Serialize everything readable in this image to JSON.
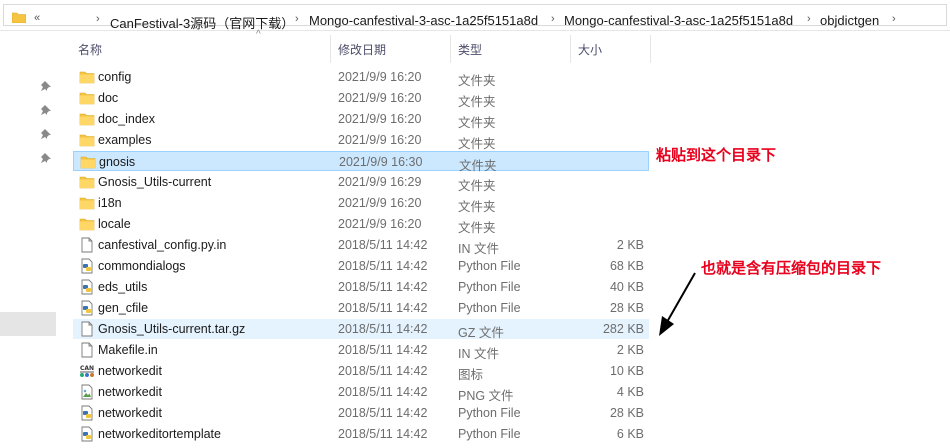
{
  "breadcrumb": {
    "back_glyph": "«",
    "items": [
      "CanFestival-3源码（官网下载）",
      "Mongo-canfestival-3-asc-1a25f5151a8d",
      "Mongo-canfestival-3-asc-1a25f5151a8d",
      "objdictgen"
    ]
  },
  "columns": {
    "name": "名称",
    "date": "修改日期",
    "type": "类型",
    "size": "大小"
  },
  "files": [
    {
      "name": "config",
      "date": "2021/9/9 16:20",
      "type": "文件夹",
      "size": "",
      "icon": "folder-icon",
      "state": ""
    },
    {
      "name": "doc",
      "date": "2021/9/9 16:20",
      "type": "文件夹",
      "size": "",
      "icon": "folder-icon",
      "state": ""
    },
    {
      "name": "doc_index",
      "date": "2021/9/9 16:20",
      "type": "文件夹",
      "size": "",
      "icon": "folder-icon",
      "state": ""
    },
    {
      "name": "examples",
      "date": "2021/9/9 16:20",
      "type": "文件夹",
      "size": "",
      "icon": "folder-icon",
      "state": ""
    },
    {
      "name": "gnosis",
      "date": "2021/9/9 16:30",
      "type": "文件夹",
      "size": "",
      "icon": "folder-icon",
      "state": "selected"
    },
    {
      "name": "Gnosis_Utils-current",
      "date": "2021/9/9 16:29",
      "type": "文件夹",
      "size": "",
      "icon": "folder-icon",
      "state": ""
    },
    {
      "name": "i18n",
      "date": "2021/9/9 16:20",
      "type": "文件夹",
      "size": "",
      "icon": "folder-icon",
      "state": ""
    },
    {
      "name": "locale",
      "date": "2021/9/9 16:20",
      "type": "文件夹",
      "size": "",
      "icon": "folder-icon",
      "state": ""
    },
    {
      "name": "canfestival_config.py.in",
      "date": "2018/5/11 14:42",
      "type": "IN 文件",
      "size": "2 KB",
      "icon": "file-icon",
      "state": ""
    },
    {
      "name": "commondialogs",
      "date": "2018/5/11 14:42",
      "type": "Python File",
      "size": "68 KB",
      "icon": "python-file-icon",
      "state": ""
    },
    {
      "name": "eds_utils",
      "date": "2018/5/11 14:42",
      "type": "Python File",
      "size": "40 KB",
      "icon": "python-file-icon",
      "state": ""
    },
    {
      "name": "gen_cfile",
      "date": "2018/5/11 14:42",
      "type": "Python File",
      "size": "28 KB",
      "icon": "python-file-icon",
      "state": ""
    },
    {
      "name": "Gnosis_Utils-current.tar.gz",
      "date": "2018/5/11 14:42",
      "type": "GZ 文件",
      "size": "282 KB",
      "icon": "file-icon",
      "state": "hover"
    },
    {
      "name": "Makefile.in",
      "date": "2018/5/11 14:42",
      "type": "IN 文件",
      "size": "2 KB",
      "icon": "file-icon",
      "state": ""
    },
    {
      "name": "networkedit",
      "date": "2018/5/11 14:42",
      "type": "图标",
      "size": "10 KB",
      "icon": "can-icon",
      "state": ""
    },
    {
      "name": "networkedit",
      "date": "2018/5/11 14:42",
      "type": "PNG 文件",
      "size": "4 KB",
      "icon": "image-file-icon",
      "state": ""
    },
    {
      "name": "networkedit",
      "date": "2018/5/11 14:42",
      "type": "Python File",
      "size": "28 KB",
      "icon": "python-file-icon",
      "state": ""
    },
    {
      "name": "networkeditortemplate",
      "date": "2018/5/11 14:42",
      "type": "Python File",
      "size": "6 KB",
      "icon": "python-file-icon",
      "state": ""
    }
  ],
  "annotations": {
    "paste_here": "粘贴到这个目录下",
    "archive_dir": "也就是含有压缩包的目录下"
  },
  "colors": {
    "annotation": "#e8001c",
    "selected": "#cce8ff",
    "hover": "#e5f3ff",
    "folder": "#f5c542"
  }
}
